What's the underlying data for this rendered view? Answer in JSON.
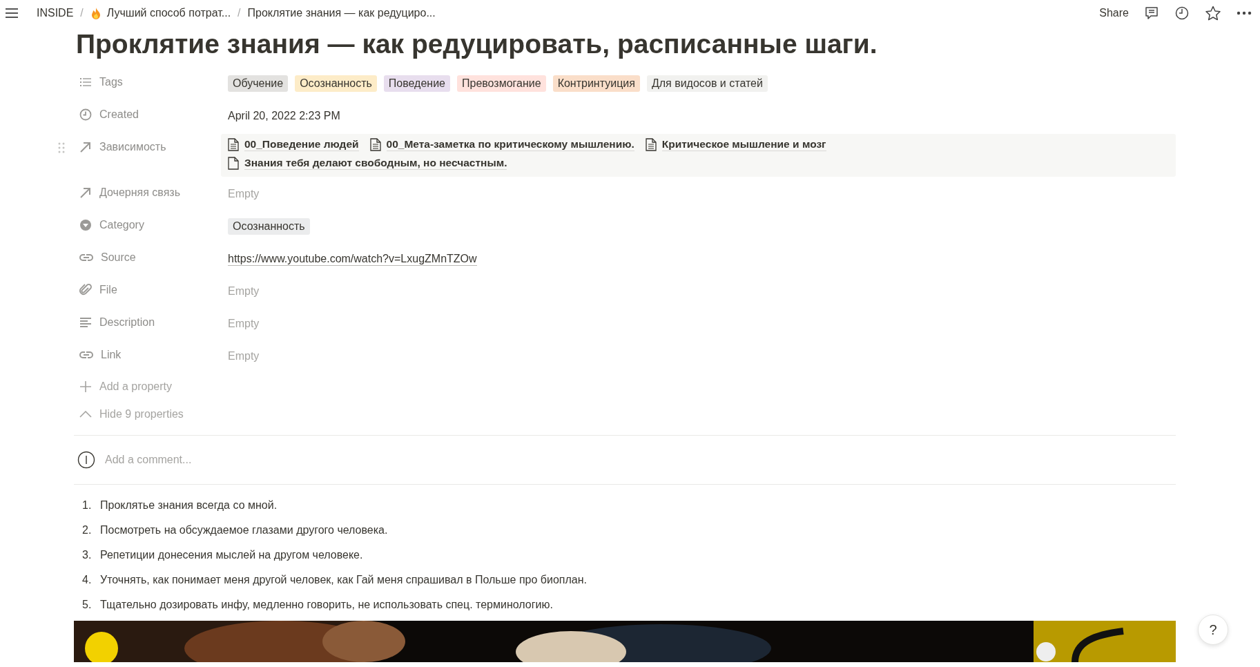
{
  "topbar": {
    "breadcrumbs": [
      {
        "label": "INSIDE",
        "icon": false
      },
      {
        "separator": "/",
        "label": "Лучший способ потрат...",
        "icon": true
      },
      {
        "separator": "/",
        "label": "Проклятие знания — как редуциро...",
        "icon": false
      }
    ],
    "share": "Share"
  },
  "title": "Проклятие знания — как редуцировать, расписанные шаги.",
  "properties": [
    {
      "label": "Tags",
      "kind": "multi_select",
      "hovered": false,
      "tags": [
        {
          "label": "Обучение",
          "color": "#e3e2e0"
        },
        {
          "label": "Осознанность",
          "color": "#fdecc8"
        },
        {
          "label": "Поведение",
          "color": "#e8deee"
        },
        {
          "label": "Превозмогание",
          "color": "#ffe2dd"
        },
        {
          "label": "Контринтуиция",
          "color": "#fadec9"
        },
        {
          "label": "Для видосов и статей",
          "color": "#f1f1ef"
        }
      ]
    },
    {
      "label": "Created",
      "kind": "created_time",
      "hovered": false,
      "value": "April 20, 2022 2:23 PM"
    },
    {
      "label": "Зависимость",
      "kind": "relation",
      "hovered": true,
      "pages": [
        "00_Поведение людей",
        "00_Мета-заметка по критическому мышлению.",
        "Критическое мышление и мозг",
        "Знания тебя делают свободным, но несчастным."
      ]
    },
    {
      "label": "Дочерняя связь",
      "kind": "relation",
      "hovered": false,
      "empty_text": "Empty"
    },
    {
      "label": "Category",
      "kind": "select",
      "hovered": false,
      "tags": [
        {
          "label": "Осознанность",
          "color": "#ebeced"
        }
      ]
    },
    {
      "label": "Source",
      "kind": "url",
      "hovered": false,
      "value": "https://www.youtube.com/watch?v=LxugZMnTZOw"
    },
    {
      "label": "File",
      "kind": "file",
      "hovered": false,
      "empty_text": "Empty"
    },
    {
      "label": "Description",
      "kind": "text",
      "hovered": false,
      "empty_text": "Empty"
    },
    {
      "label": "Link",
      "kind": "url",
      "hovered": false,
      "empty_text": "Empty"
    }
  ],
  "add_property": "Add a property",
  "hide_properties": "Hide 9 properties",
  "comment": {
    "placeholder": "Add a comment..."
  },
  "list": [
    {
      "number": "1.",
      "text": "Проклятье знания всегда со мной."
    },
    {
      "number": "2.",
      "text": "Посмотреть на обсуждаемое глазами другого человека."
    },
    {
      "number": "3.",
      "text": "Репетиции донесения мыслей на другом человеке."
    },
    {
      "number": "4.",
      "text": "Уточнять, как понимает меня другой человек, как Гай меня спрашивал в Польше про биоплан."
    },
    {
      "number": "5.",
      "text": "Тщательно дозировать инфу, медленно говорить, не использовать спец. терминологию."
    }
  ],
  "help": "?"
}
